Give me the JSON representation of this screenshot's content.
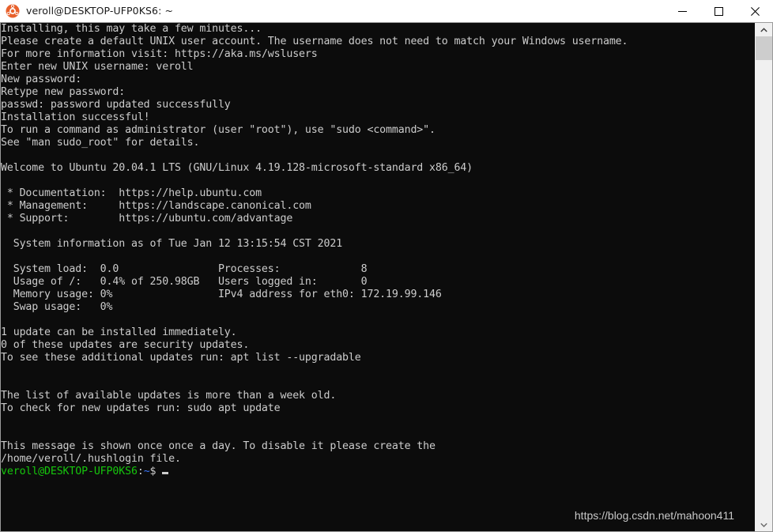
{
  "window": {
    "title": "veroll@DESKTOP-UFP0KS6: ~",
    "app_icon": "ubuntu-logo-icon",
    "controls": {
      "minimize": "minimize-icon",
      "maximize": "maximize-icon",
      "close": "close-icon"
    },
    "titlebar_bg": "#ffffff",
    "terminal_bg": "#0c0c0c"
  },
  "terminal": {
    "foreground": "#cccccc",
    "prompt_user_color": "#16c60c",
    "prompt_path_color": "#3b78ff",
    "lines": [
      "Installing, this may take a few minutes...",
      "Please create a default UNIX user account. The username does not need to match your Windows username.",
      "For more information visit: https://aka.ms/wslusers",
      "Enter new UNIX username: veroll",
      "New password:",
      "Retype new password:",
      "passwd: password updated successfully",
      "Installation successful!",
      "To run a command as administrator (user \"root\"), use \"sudo <command>\".",
      "See \"man sudo_root\" for details.",
      "",
      "Welcome to Ubuntu 20.04.1 LTS (GNU/Linux 4.19.128-microsoft-standard x86_64)",
      "",
      " * Documentation:  https://help.ubuntu.com",
      " * Management:     https://landscape.canonical.com",
      " * Support:        https://ubuntu.com/advantage",
      "",
      "  System information as of Tue Jan 12 13:15:54 CST 2021",
      "",
      "  System load:  0.0                Processes:             8",
      "  Usage of /:   0.4% of 250.98GB   Users logged in:       0",
      "  Memory usage: 0%                 IPv4 address for eth0: 172.19.99.146",
      "  Swap usage:   0%",
      "",
      "1 update can be installed immediately.",
      "0 of these updates are security updates.",
      "To see these additional updates run: apt list --upgradable",
      "",
      "",
      "The list of available updates is more than a week old.",
      "To check for new updates run: sudo apt update",
      "",
      "",
      "This message is shown once once a day. To disable it please create the",
      "/home/veroll/.hushlogin file."
    ],
    "prompt": {
      "user_host": "veroll@DESKTOP-UFP0KS6",
      "separator": ":",
      "path": "~",
      "symbol": "$",
      "cursor": "block-cursor"
    }
  },
  "system_info": {
    "timestamp": "Tue Jan 12 13:15:54 CST 2021",
    "system_load": "0.0",
    "usage_of_root": "0.4% of 250.98GB",
    "memory_usage": "0%",
    "swap_usage": "0%",
    "processes": "8",
    "users_logged_in": "0",
    "ipv4_address_eth0": "172.19.99.146"
  },
  "watermark": {
    "text": "https://blog.csdn.net/mahoon411"
  },
  "scrollbar": {
    "up_arrow": "chevron-up-icon",
    "down_arrow": "chevron-down-icon",
    "track_color": "#f0f0f0",
    "thumb_color": "#cdcdcd"
  }
}
